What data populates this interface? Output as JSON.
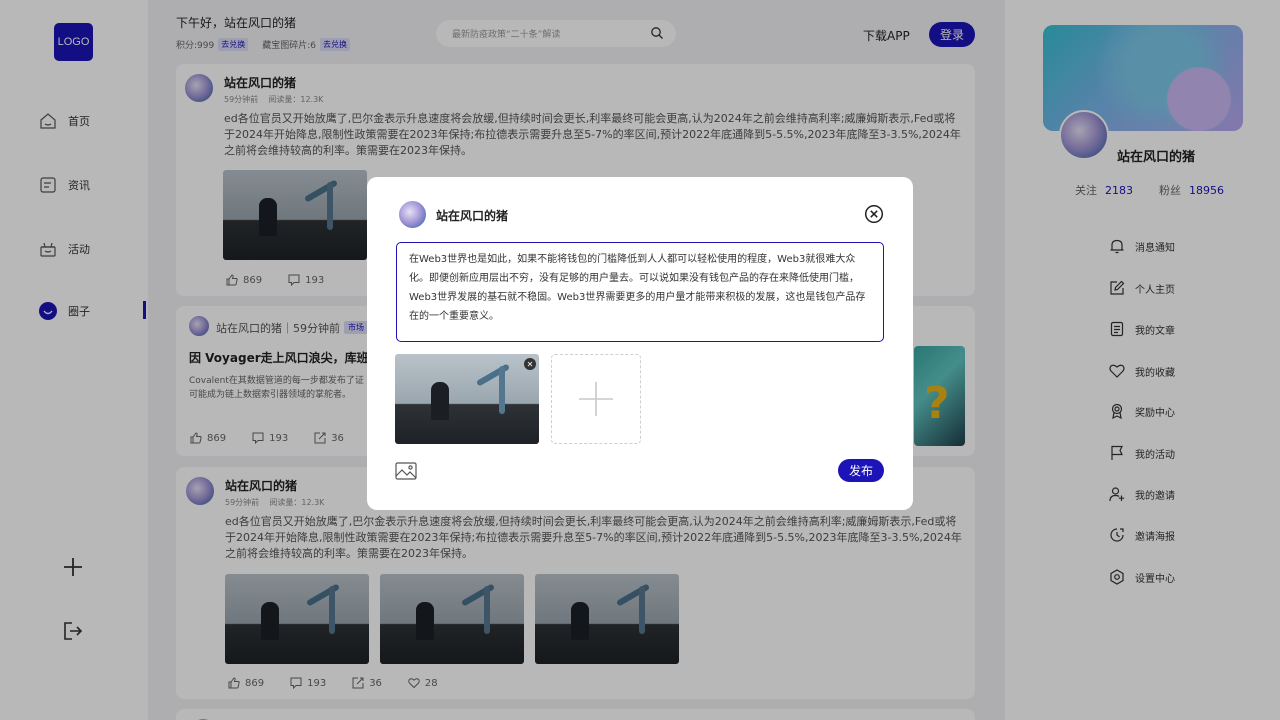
{
  "logo": "LOGO",
  "nav": [
    {
      "label": "首页",
      "icon": "home-icon"
    },
    {
      "label": "资讯",
      "icon": "news-icon"
    },
    {
      "label": "活动",
      "icon": "activity-icon"
    },
    {
      "label": "圈子",
      "icon": "circle-icon",
      "active": true
    }
  ],
  "header": {
    "greeting": "下午好，站在风口的猪",
    "points_label": "积分:999",
    "points_tag": "去兑换",
    "fragments_label": "藏宝图碎片:6",
    "fragments_tag": "去兑换",
    "search_placeholder": "最新防疫政策“二十条”解读",
    "download": "下载APP",
    "login": "登录"
  },
  "feed": {
    "post1": {
      "user": "站在风口的猪",
      "time": "59分钟前",
      "reads": "阅读量：12.3K",
      "text": "ed各位官员又开始放鹰了,巴尔金表示升息速度将会放缓,但持续时间会更长,利率最终可能会更高,认为2024年之前会维持高利率;威廉姆斯表示,Fed或将于2024年开始降息,限制性政策需要在2023年保持;布拉德表示需要升息至5-7%的率区间,预计2022年底通降到5-5.5%,2023年底降至3-3.5%,2024年之前将会维持较高的利率。策需要在2023年保持。",
      "likes": "869",
      "comments": "193"
    },
    "post2": {
      "user": "站在风口的猪｜59分钟前",
      "tag": "市场",
      "title": "因 Voyager走上风口浪尖，库班有",
      "text1": "Covalent在其数据管道的每一步都发布了证",
      "text2": "可能成为链上数据索引器领域的掌舵者。",
      "likes": "869",
      "comments": "193",
      "shares": "36"
    },
    "post3": {
      "user": "站在风口的猪",
      "time": "59分钟前",
      "reads": "阅读量：12.3K",
      "text": "ed各位官员又开始放鹰了,巴尔金表示升息速度将会放缓,但持续时间会更长,利率最终可能会更高,认为2024年之前会维持高利率;威廉姆斯表示,Fed或将于2024年开始降息,限制性政策需要在2023年保持;布拉德表示需要升息至5-7%的率区间,预计2022年底通降到5-5.5%,2023年底降至3-3.5%,2024年之前将会维持较高的利率。策需要在2023年保持。",
      "likes": "869",
      "comments": "193",
      "shares": "36",
      "favs": "28"
    }
  },
  "profile": {
    "name": "站在风口的猪",
    "follow_label": "关注",
    "follow_count": "2183",
    "fans_label": "粉丝",
    "fans_count": "18956"
  },
  "menu": [
    {
      "label": "消息通知",
      "icon": "bell-icon"
    },
    {
      "label": "个人主页",
      "icon": "edit-icon"
    },
    {
      "label": "我的文章",
      "icon": "document-icon"
    },
    {
      "label": "我的收藏",
      "icon": "heart-icon"
    },
    {
      "label": "奖励中心",
      "icon": "award-icon"
    },
    {
      "label": "我的活动",
      "icon": "flag-icon"
    },
    {
      "label": "我的邀请",
      "icon": "add-user-icon"
    },
    {
      "label": "邀请海报",
      "icon": "poster-icon"
    },
    {
      "label": "设置中心",
      "icon": "gear-icon"
    }
  ],
  "modal": {
    "user": "站在风口的猪",
    "text": "在Web3世界也是如此，如果不能将钱包的门槛降低到人人都可以轻松使用的程度，Web3就很难大众化。即便创新应用层出不穷，没有足够的用户量去。可以说如果没有钱包产品的存在来降低使用门槛，Web3世界发展的基石就不稳固。Web3世界需要更多的用户量才能带来积极的发展，这也是钱包产品存在的一个重要意义。",
    "publish": "发布"
  }
}
